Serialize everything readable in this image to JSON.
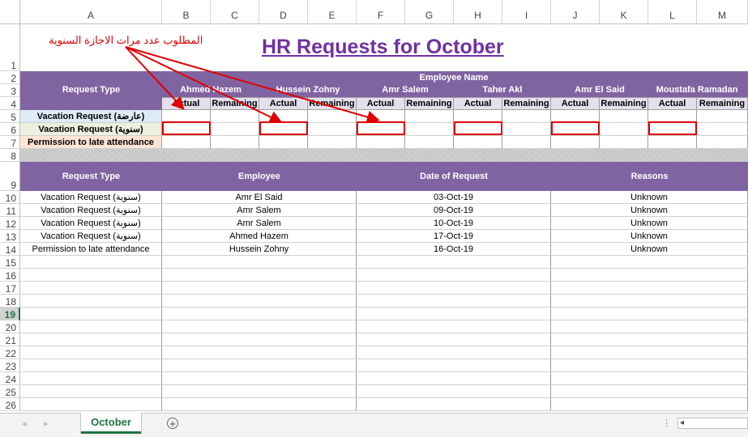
{
  "columns": [
    "A",
    "B",
    "C",
    "D",
    "E",
    "F",
    "G",
    "H",
    "I",
    "J",
    "K",
    "L",
    "M"
  ],
  "rows": [
    "1",
    "2",
    "3",
    "4",
    "5",
    "6",
    "7",
    "8",
    "9",
    "10",
    "11",
    "12",
    "13",
    "14",
    "15",
    "16",
    "17",
    "18",
    "19",
    "20",
    "21",
    "22",
    "23",
    "24",
    "25",
    "26"
  ],
  "active_row": "19",
  "title": "HR Requests for October",
  "annotation": "المطلوب عدد مرات الاجازة السنوية",
  "top_table": {
    "request_type_header": "Request Type",
    "employee_name_header": "Employee Name",
    "employees": [
      "Ahmed Hazem",
      "Hussein Zohny",
      "Amr Salem",
      "Taher Akl",
      "Amr El Said",
      "Moustafa Ramadan"
    ],
    "actual_label": "Actual",
    "remaining_label": "Remaining",
    "request_types": [
      "Vacation Request (عارضة)",
      "Vacation Request (سنوية)",
      "Permission to late attendance"
    ]
  },
  "bottom_table": {
    "headers": [
      "Request Type",
      "Employee",
      "Date of Request",
      "Reasons"
    ],
    "rows": [
      [
        "Vacation Request (سنوية)",
        "Amr El Said",
        "03-Oct-19",
        "Unknown"
      ],
      [
        "Vacation Request (سنوية)",
        "Amr Salem",
        "09-Oct-19",
        "Unknown"
      ],
      [
        "Vacation Request (سنوية)",
        "Amr Salem",
        "10-Oct-19",
        "Unknown"
      ],
      [
        "Vacation Request (سنوية)",
        "Ahmed Hazem",
        "17-Oct-19",
        "Unknown"
      ],
      [
        "Permission to late attendance",
        "Hussein Zohny",
        "16-Oct-19",
        "Unknown"
      ]
    ]
  },
  "sheet_tab": "October",
  "colors": {
    "purple": "#8064a2",
    "title": "#7030a0",
    "annotation": "#e00000",
    "tab": "#217346"
  }
}
